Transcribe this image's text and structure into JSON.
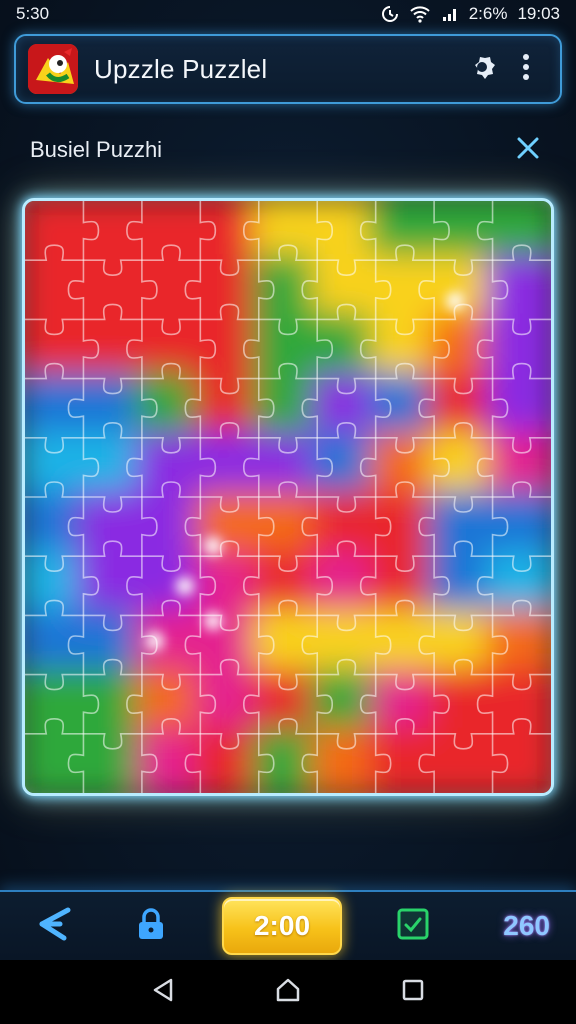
{
  "status_bar": {
    "time_left": "5:30",
    "battery": "2:6%",
    "time_right": "19:03",
    "icons": [
      "sync-icon",
      "wifi-icon",
      "signal-icon"
    ]
  },
  "app_bar": {
    "title": "Upzzle Puzzlel",
    "logo_icon": "app-logo-icon",
    "actions": [
      "settings-gear-icon",
      "more-vert-icon"
    ]
  },
  "puzzle_header": {
    "title": "Busiel Puzzhi",
    "close_icon": "close-icon"
  },
  "board": {
    "columns": 9,
    "rows": 10
  },
  "toolbar": {
    "back_icon": "share-arrow-icon",
    "lock_icon": "lock-icon",
    "timer": "2:00",
    "check_icon": "check-square-icon",
    "score": "260"
  },
  "nav_bar": {
    "items": [
      "back-triangle-icon",
      "home-icon",
      "recents-square-icon"
    ]
  },
  "colors": {
    "accent_blue": "#3f9bd8",
    "timer_yellow": "#f7c21a",
    "score_purple": "#8fc7ff",
    "piece_palette": [
      "#e9282a",
      "#f46a15",
      "#f9d21b",
      "#2ea83a",
      "#1f74d6",
      "#8a2be2",
      "#e4208f",
      "#1fb3e6"
    ]
  }
}
